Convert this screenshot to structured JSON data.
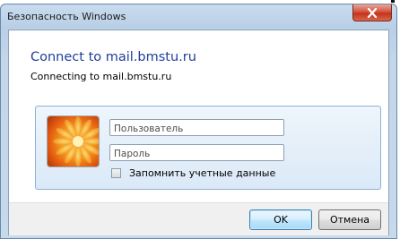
{
  "window": {
    "title": "Безопасность Windows",
    "close_icon": "close-x-icon"
  },
  "dialog": {
    "heading": "Connect to mail.bmstu.ru",
    "subheading": "Connecting to mail.bmstu.ru"
  },
  "credentials": {
    "user_icon": "user-tile-flower-icon",
    "username": {
      "value": "",
      "placeholder": "Пользователь"
    },
    "password": {
      "value": "",
      "placeholder": "Пароль"
    },
    "remember": {
      "label": "Запомнить учетные данные",
      "checked": false
    }
  },
  "buttons": {
    "ok_label": "OK",
    "cancel_label": "Отмена"
  },
  "colors": {
    "heading": "#1f3f9b",
    "close_button": "#c4331a",
    "panel_border": "#8fb2d6",
    "default_button_border": "#3c7fb1"
  }
}
